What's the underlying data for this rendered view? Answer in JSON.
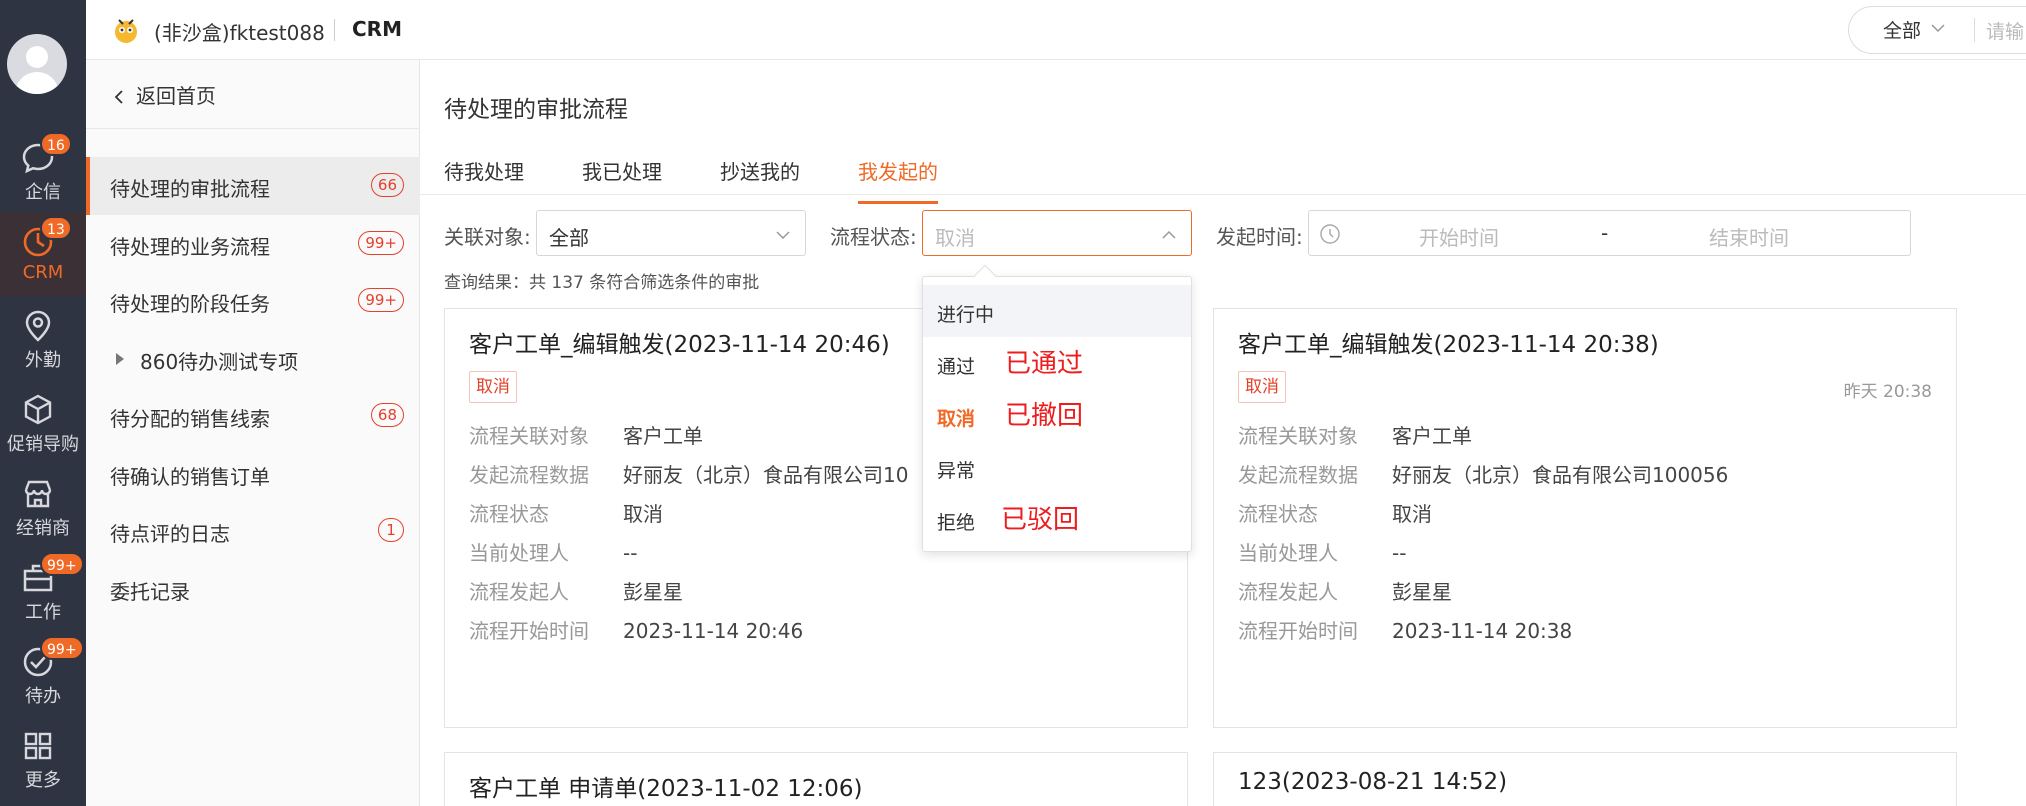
{
  "rail": {
    "items": [
      {
        "label": "企信",
        "badge": "16",
        "icon": "chat-bubble-icon"
      },
      {
        "label": "CRM",
        "badge": "13",
        "icon": "crm-ring-icon",
        "active": true
      },
      {
        "label": "外勤",
        "badge": "",
        "icon": "map-pin-icon"
      },
      {
        "label": "促销导购",
        "badge": "",
        "icon": "cube-icon"
      },
      {
        "label": "经销商",
        "badge": "",
        "icon": "store-icon"
      },
      {
        "label": "工作",
        "badge": "99+",
        "icon": "briefcase-icon"
      },
      {
        "label": "待办",
        "badge": "99+",
        "icon": "check-circle-icon"
      },
      {
        "label": "更多",
        "badge": "",
        "icon": "grid-icon"
      }
    ]
  },
  "header": {
    "tenant": "(非沙盒)fktest088",
    "app": "CRM",
    "search_scope": "全部",
    "search_placeholder": "请输"
  },
  "sidebar": {
    "back": "返回首页",
    "items": [
      {
        "label": "待处理的审批流程",
        "count": "66",
        "active": true
      },
      {
        "label": "待处理的业务流程",
        "count": "99+"
      },
      {
        "label": "待处理的阶段任务",
        "count": "99+"
      },
      {
        "label": "860待办测试专项",
        "count": "",
        "group": true
      },
      {
        "label": "待分配的销售线索",
        "count": "68"
      },
      {
        "label": "待确认的销售订单",
        "count": ""
      },
      {
        "label": "待点评的日志",
        "count": "1"
      },
      {
        "label": "委托记录",
        "count": ""
      }
    ]
  },
  "main": {
    "title": "待处理的审批流程",
    "tabs": [
      "待我处理",
      "我已处理",
      "抄送我的",
      "我发起的"
    ],
    "active_tab": 3,
    "filters": {
      "object_label": "关联对象:",
      "object_value": "全部",
      "status_label": "流程状态:",
      "status_value": "取消",
      "time_label": "发起时间:",
      "start_placeholder": "开始时间",
      "sep": "-",
      "end_placeholder": "结束时间"
    },
    "result_text": "查询结果：共 137 条符合筛选条件的审批",
    "status_options": [
      {
        "label": "进行中",
        "hover": true
      },
      {
        "label": "通过",
        "annotation": "已通过"
      },
      {
        "label": "取消",
        "selected": true,
        "annotation": "已撤回"
      },
      {
        "label": "异常"
      },
      {
        "label": "拒绝",
        "annotation": "已驳回"
      }
    ],
    "field_labels": [
      "流程关联对象",
      "发起流程数据",
      "流程状态",
      "当前处理人",
      "流程发起人",
      "流程开始时间"
    ],
    "cards": [
      {
        "title": "客户工单_编辑触发(2023-11-14 20:46)",
        "tag": "取消",
        "time": "",
        "values": [
          "客户工单",
          "好丽友（北京）食品有限公司10",
          "取消",
          "--",
          "彭星星",
          "2023-11-14 20:46"
        ]
      },
      {
        "title": "客户工单_编辑触发(2023-11-14 20:38)",
        "tag": "取消",
        "time": "昨天 20:38",
        "values": [
          "客户工单",
          "好丽友（北京）食品有限公司100056",
          "取消",
          "--",
          "彭星星",
          "2023-11-14 20:38"
        ]
      },
      {
        "title": "客户工单 申请单(2023-11-02 12:06)"
      },
      {
        "title": "123(2023-08-21 14:52)"
      }
    ]
  },
  "colors": {
    "accent": "#f06a27",
    "rail_bg": "#2e3441",
    "badge_red": "#e4412b",
    "annotation_red": "#ee1c1c"
  }
}
